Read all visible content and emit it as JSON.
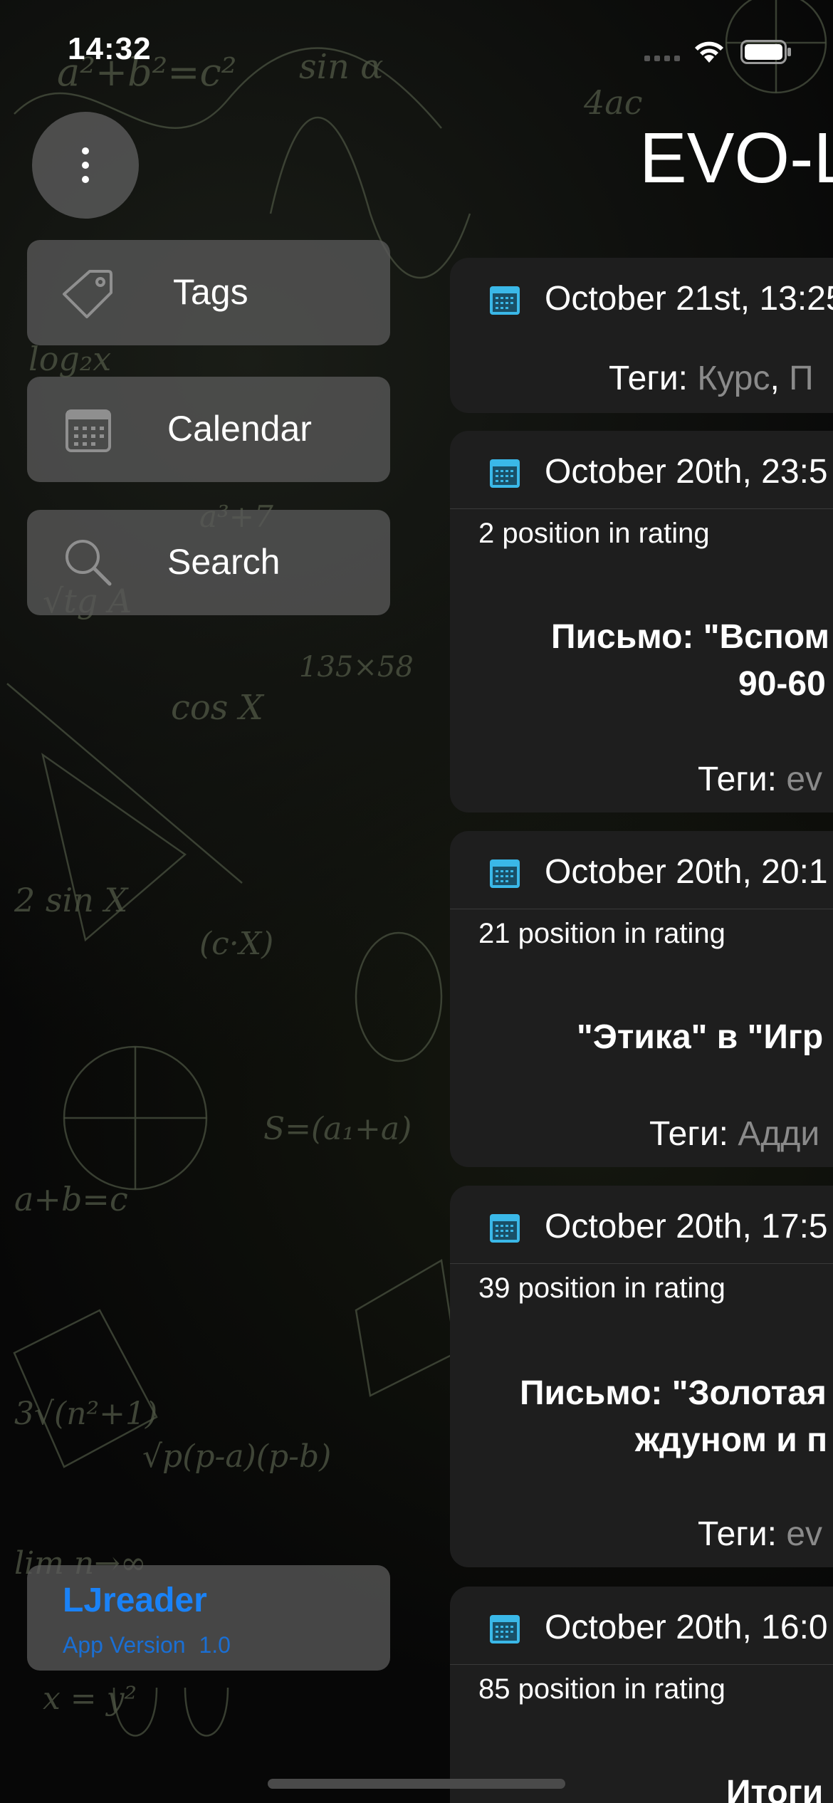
{
  "status_bar": {
    "time": "14:32"
  },
  "header": {
    "title": "EVO-L"
  },
  "side_menu": {
    "items": [
      {
        "label": "Tags",
        "icon": "tag-icon"
      },
      {
        "label": "Calendar",
        "icon": "calendar-icon"
      },
      {
        "label": "Search",
        "icon": "search-icon"
      }
    ]
  },
  "app_info": {
    "name": "LJreader",
    "version_label": "App Version",
    "version": "1.0"
  },
  "posts": [
    {
      "date": "October 21st, 13:25",
      "tags_label": "Теги:",
      "tags": [
        "Курс",
        "П"
      ],
      "rating": "",
      "title_lines": []
    },
    {
      "date": "October 20th, 23:5",
      "rating": "2 position in rating",
      "title_lines": [
        "Письмо: \"Вспом",
        "90-60"
      ],
      "tags_label": "Теги:",
      "tags": [
        "ev"
      ]
    },
    {
      "date": "October 20th, 20:1",
      "rating": "21 position in rating",
      "title_lines": [
        "\"Этика\" в \"Игр"
      ],
      "tags_label": "Теги:",
      "tags": [
        "Адди"
      ]
    },
    {
      "date": "October 20th, 17:5",
      "rating": "39 position in rating",
      "title_lines": [
        "Письмо: \"Золотая",
        "ждуном и п"
      ],
      "tags_label": "Теги:",
      "tags": [
        "ev"
      ]
    },
    {
      "date": "October 20th, 16:0",
      "rating": "85 position in rating",
      "title_lines": [
        "Итоги"
      ],
      "tags_label": "",
      "tags": []
    }
  ],
  "colors": {
    "accent": "#1a82f7",
    "calendar_icon": "#3ab8e8",
    "card": "#1e1e1e",
    "menu_item": "#585858"
  }
}
